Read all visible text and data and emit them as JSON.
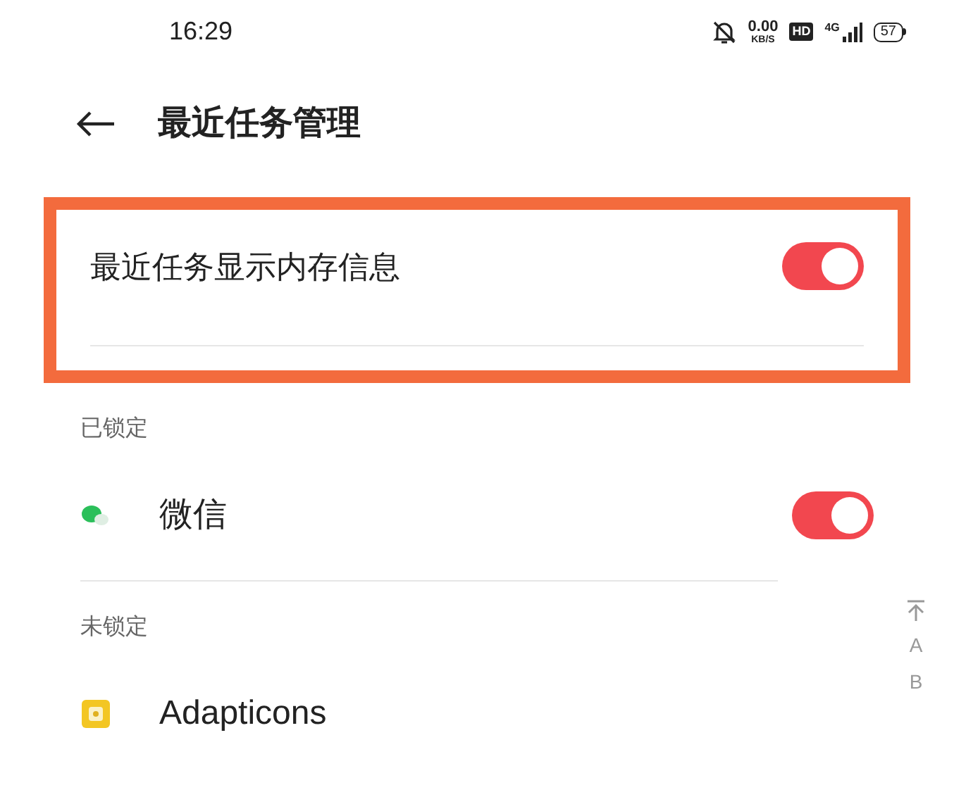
{
  "status_bar": {
    "time": "16:29",
    "net_speed": "0.00",
    "net_unit": "KB/S",
    "hd": "HD",
    "network": "4G",
    "battery": "57"
  },
  "header": {
    "title": "最近任务管理"
  },
  "memory_setting": {
    "label": "最近任务显示内存信息",
    "on": true,
    "highlighted": true
  },
  "sections": [
    {
      "title": "已锁定",
      "apps": [
        {
          "name": "微信",
          "kind": "chat",
          "on": true
        }
      ]
    },
    {
      "title": "未锁定",
      "apps": [
        {
          "name": "Adapticons",
          "kind": "square"
        }
      ]
    }
  ],
  "index_bar": [
    "A",
    "B"
  ]
}
